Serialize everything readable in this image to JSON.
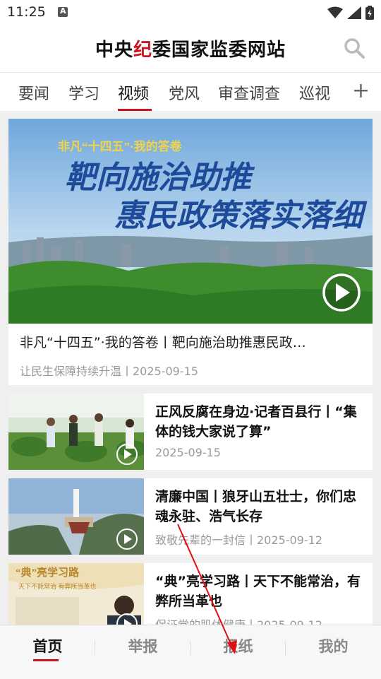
{
  "status_bar": {
    "time": "11:25",
    "a_badge": "A"
  },
  "header": {
    "title_part1": "中央",
    "title_highlight": "纪",
    "title_part2": "委国家监委网站"
  },
  "tabs": [
    {
      "label": "要闻"
    },
    {
      "label": "学习"
    },
    {
      "label": "视频"
    },
    {
      "label": "党风"
    },
    {
      "label": "审查调查"
    },
    {
      "label": "巡视"
    }
  ],
  "tabs_plus": "+",
  "hero": {
    "overlay_small": "非凡“十四五”·我的答卷",
    "overlay_big1": "靶向施治助推",
    "overlay_big2": "惠民政策落实落细",
    "title": "非凡“十四五”·我的答卷丨靶向施治助推惠民政…",
    "meta": "让民生保障持续升温丨2025-09-15"
  },
  "articles": [
    {
      "title": "正风反腐在身边·记者百县行丨“集体的钱大家说了算”",
      "meta": "2025-09-15"
    },
    {
      "title": "清廉中国丨狼牙山五壮士，你们忠魂永驻、浩气长存",
      "meta": "致敬先辈的一封信丨2025-09-12"
    },
    {
      "title": "“典”亮学习路丨天下不能常治，有弊所当革也",
      "meta": "保证党的肌体健康丨2025-09-12",
      "thumb_text1": "“典”亮学习路",
      "thumb_text2": "天下不能常治 有弊所当革也"
    }
  ],
  "bottom_nav": [
    {
      "label": "首页"
    },
    {
      "label": "举报"
    },
    {
      "label": "报纸"
    },
    {
      "label": "我的"
    }
  ],
  "colors": {
    "accent": "#c8161d",
    "annotation_arrow": "#e01010"
  }
}
